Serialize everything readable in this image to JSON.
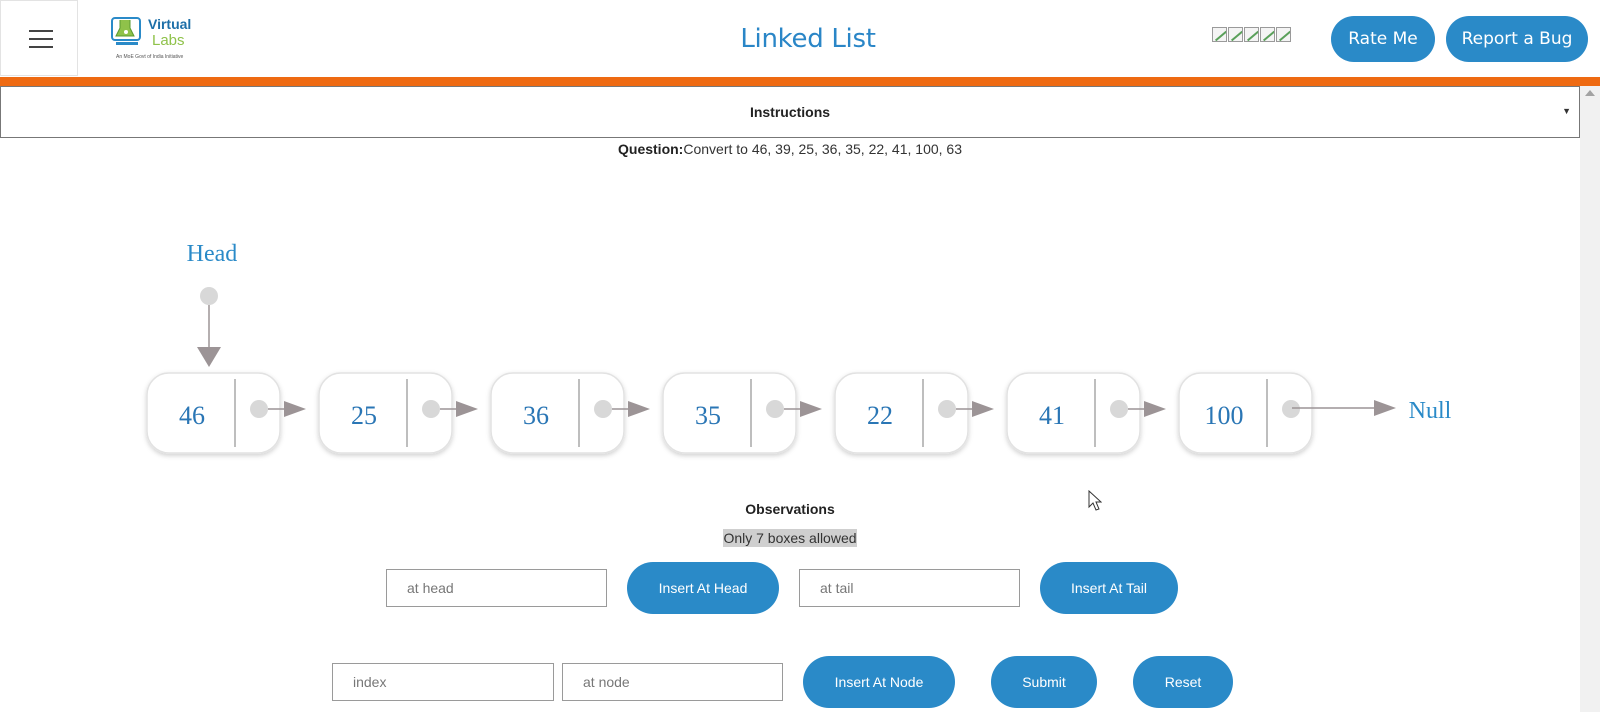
{
  "header": {
    "title": "Linked List",
    "rate_label": "Rate Me",
    "bug_label": "Report a Bug",
    "logo_text_top": "Virtual",
    "logo_text_bottom": "Labs",
    "logo_tagline": "An MoE Govt of India Initiative"
  },
  "instructions": {
    "label": "Instructions"
  },
  "question": {
    "prefix": "Question:",
    "text": "Convert to 46, 39, 25, 36, 35, 22, 41, 100, 63"
  },
  "list": {
    "head_label": "Head",
    "null_label": "Null",
    "nodes": [
      "46",
      "25",
      "36",
      "35",
      "22",
      "41",
      "100"
    ]
  },
  "observations": {
    "title": "Observations",
    "message": "Only 7 boxes allowed"
  },
  "controls": {
    "at_head_placeholder": "at head",
    "insert_head_label": "Insert At Head",
    "at_tail_placeholder": "at tail",
    "insert_tail_label": "Insert At Tail",
    "index_placeholder": "index",
    "at_node_placeholder": "at node",
    "insert_node_label": "Insert At Node",
    "submit_label": "Submit",
    "reset_label": "Reset"
  },
  "colors": {
    "accent": "#2a8ac8",
    "bar": "#ee6a12",
    "node_border": "#e2e2e2",
    "arrow": "#9c9496"
  }
}
